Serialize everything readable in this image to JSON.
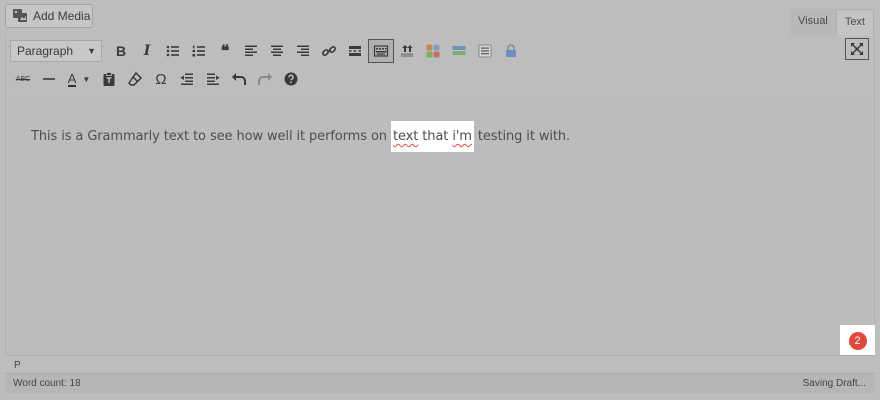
{
  "media": {
    "add_label": "Add Media"
  },
  "tabs": [
    {
      "label": "Visual",
      "active": false
    },
    {
      "label": "Text",
      "active": true
    }
  ],
  "toolbar": {
    "format_select": "Paragraph",
    "row1_icons": [
      "bold-icon",
      "italic-icon",
      "bulleted-list-icon",
      "numbered-list-icon",
      "blockquote-icon",
      "align-left-icon",
      "align-center-icon",
      "align-right-icon",
      "link-icon",
      "read-more-icon",
      "toolbar-toggle-icon",
      "upload-icon",
      "grid-icon",
      "highlight-icon",
      "list-box-icon",
      "lock-icon"
    ],
    "row2_icons": [
      "strikethrough-icon",
      "horizontal-line-icon",
      "text-color-icon",
      "paste-as-text-icon",
      "clear-formatting-icon",
      "special-character-icon",
      "outdent-icon",
      "indent-icon",
      "undo-icon",
      "redo-icon",
      "help-icon"
    ],
    "bold_glyph": "B",
    "italic_glyph": "I",
    "text_color_glyph": "A",
    "omega_glyph": "Ω",
    "abc_glyph": "ABC",
    "quote_glyph": "❝"
  },
  "editor": {
    "text_before": "This is a Grammarly text to see how well it performs on ",
    "hl_word1": "text",
    "hl_mid": " that ",
    "hl_word2": "i'm",
    "text_after": " testing it with."
  },
  "grammarly_badge": {
    "count": "2",
    "color": "#e2473e"
  },
  "path": {
    "element": "P"
  },
  "status": {
    "word_count": "Word count: 18",
    "save_state": "Saving Draft..."
  }
}
